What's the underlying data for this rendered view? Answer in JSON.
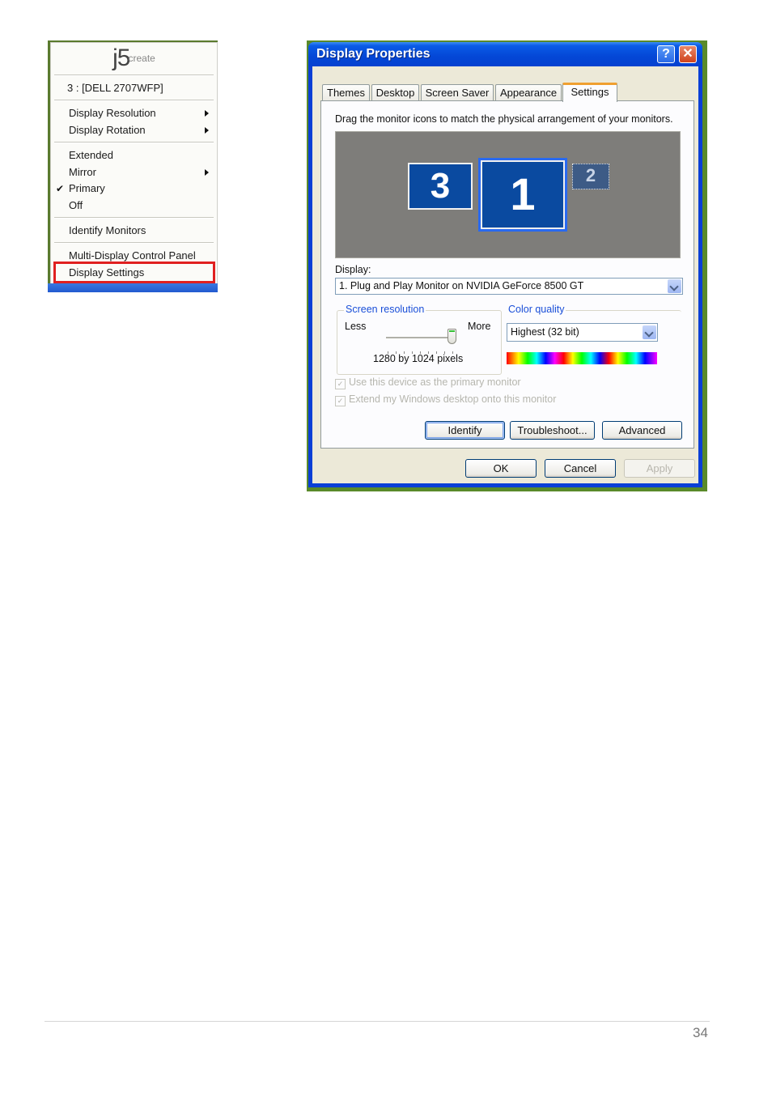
{
  "context_menu": {
    "logo": {
      "brand_main": "j5",
      "brand_sub": "create"
    },
    "monitor_label": "3 : [DELL 2707WFP]",
    "items": [
      {
        "label": "Display Resolution",
        "submenu": true
      },
      {
        "label": "Display Rotation",
        "submenu": true
      },
      {
        "label": "Extended",
        "submenu": false
      },
      {
        "label": "Mirror",
        "submenu": true
      },
      {
        "label": "Primary",
        "checked": true
      },
      {
        "label": "Off",
        "submenu": false
      },
      {
        "label": "Identify Monitors",
        "submenu": false
      },
      {
        "label": "Multi-Display Control Panel",
        "submenu": false
      },
      {
        "label": "Display Settings",
        "highlighted": true
      }
    ],
    "highlight_color": "#e02020"
  },
  "dialog": {
    "title": "Display Properties",
    "help_glyph": "?",
    "close_glyph": "✕",
    "tabs": [
      {
        "label": "Themes",
        "active": false
      },
      {
        "label": "Desktop",
        "active": false
      },
      {
        "label": "Screen Saver",
        "active": false
      },
      {
        "label": "Appearance",
        "active": false
      },
      {
        "label": "Settings",
        "active": true
      }
    ],
    "instruction": "Drag the monitor icons to match the physical arrangement of your monitors.",
    "monitors": [
      {
        "number": "3",
        "selected": false
      },
      {
        "number": "1",
        "selected": true
      },
      {
        "number": "2",
        "selected": false,
        "inactive": true
      }
    ],
    "display_label": "Display:",
    "display_value": "1. Plug and Play Monitor on NVIDIA GeForce 8500 GT",
    "screen_resolution": {
      "title": "Screen resolution",
      "less_label": "Less",
      "more_label": "More",
      "value_text": "1280 by 1024 pixels",
      "slider_position": 1.0
    },
    "color_quality": {
      "title": "Color quality",
      "value": "Highest (32 bit)"
    },
    "checkboxes": [
      {
        "label": "Use this device as the primary monitor",
        "checked": true,
        "disabled": true
      },
      {
        "label": "Extend my Windows desktop onto this monitor",
        "checked": true,
        "disabled": true
      }
    ],
    "buttons": {
      "identify": "Identify",
      "troubleshoot": "Troubleshoot...",
      "advanced": "Advanced",
      "ok": "OK",
      "cancel": "Cancel",
      "apply": "Apply"
    },
    "colors": {
      "title_bar": "#0447d6",
      "accent_tab": "#f0a030",
      "group_title": "#1a4fd8"
    }
  },
  "footer": {
    "page_number": "34"
  }
}
